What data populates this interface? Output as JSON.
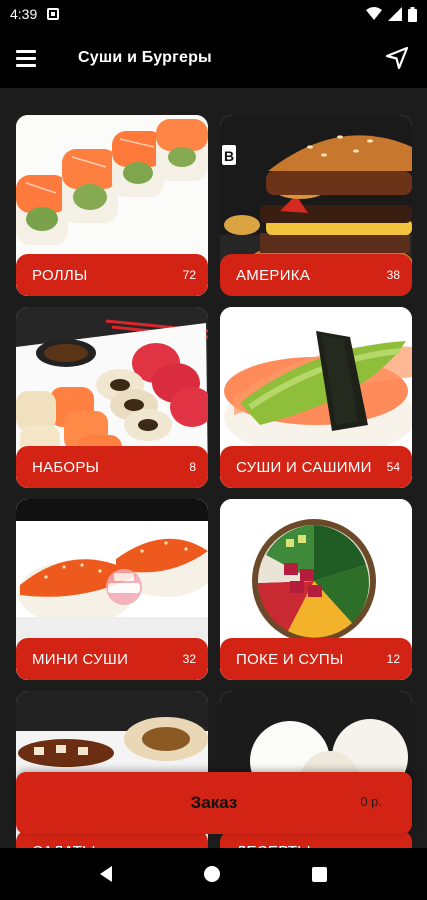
{
  "status": {
    "time": "4:39"
  },
  "app_bar": {
    "title": "Суши и Бургеры"
  },
  "categories": [
    {
      "label": "РОЛЛЫ",
      "count": "72"
    },
    {
      "label": "АМЕРИКА",
      "count": "38"
    },
    {
      "label": "НАБОРЫ",
      "count": "8"
    },
    {
      "label": "СУШИ И САШИМИ",
      "count": "54"
    },
    {
      "label": "МИНИ СУШИ",
      "count": "32"
    },
    {
      "label": "ПОКЕ И СУПЫ",
      "count": "12"
    },
    {
      "label": "САЛАТЫ",
      "count": ""
    },
    {
      "label": "ДЕСЕРТЫ",
      "count": ""
    }
  ],
  "order": {
    "label": "Заказ",
    "amount": "0 р."
  },
  "colors": {
    "accent": "#d32314",
    "background": "#1c1c1c",
    "bar": "#000000"
  }
}
